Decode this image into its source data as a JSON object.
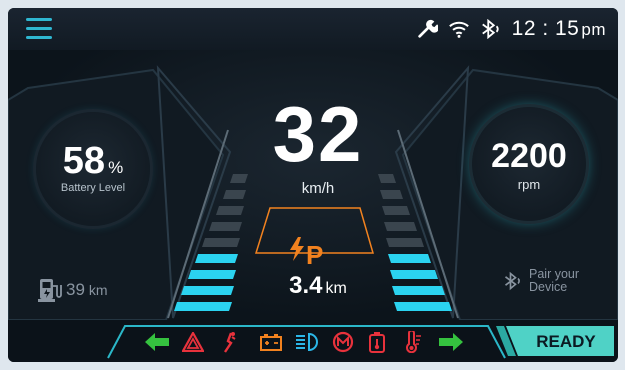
{
  "status": {
    "time": "12 : 15",
    "ampm": "pm"
  },
  "battery": {
    "value": "58",
    "unit": "%",
    "label": "Battery Level"
  },
  "speed": {
    "value": "32",
    "unit": "km/h"
  },
  "drive": {
    "gear": "P"
  },
  "trip": {
    "value": "3.4",
    "unit": "km"
  },
  "range": {
    "value": "39",
    "unit": "km"
  },
  "rpm": {
    "value": "2200",
    "unit": "rpm"
  },
  "bluetooth": {
    "line1": "Pair your",
    "line2": "Device"
  },
  "ready": {
    "label": "READY"
  },
  "colors": {
    "accent": "#2fb7d1",
    "orange": "#f2821f",
    "red": "#e8323c",
    "green": "#35c23f"
  }
}
